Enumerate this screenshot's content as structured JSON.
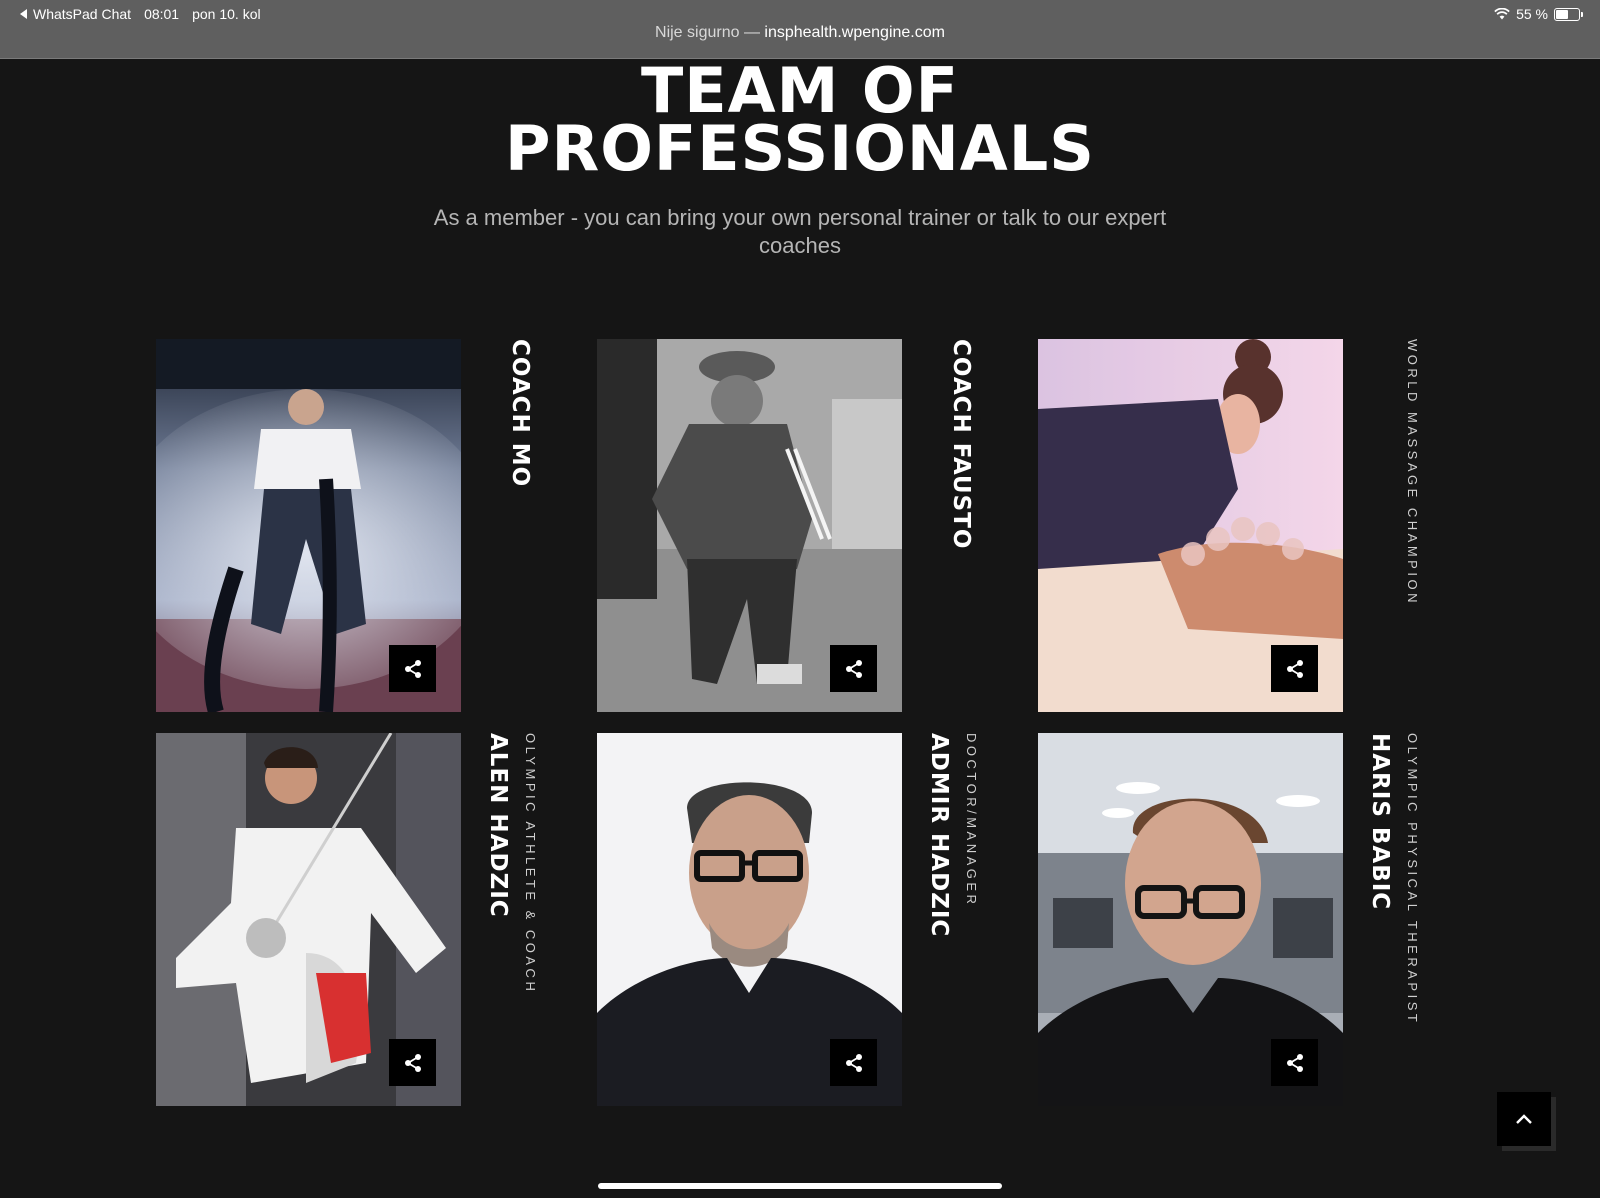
{
  "status_bar": {
    "back_app": "WhatsPad Chat",
    "time": "08:01",
    "date": "pon 10. kol",
    "battery": "55 %"
  },
  "address_bar": {
    "security": "Nije sigurno —",
    "domain": "insphealth.wpengine.com"
  },
  "section": {
    "title_line1": "TEAM OF",
    "title_line2": "PROFESSIONALS",
    "subtitle": "As a member - you can bring your own personal trainer or talk to our expert coaches"
  },
  "team": [
    {
      "name": "COACH MO",
      "role": ""
    },
    {
      "name": "COACH FAUSTO",
      "role": ""
    },
    {
      "name": "",
      "role": "WORLD MASSAGE CHAMPION"
    },
    {
      "name": "ALEN HADZIC",
      "role": "OLYMPIC ATHLETE & COACH"
    },
    {
      "name": "ADMIR HADZIC",
      "role": "DOCTOR/MANAGER"
    },
    {
      "name": "HARIS BABIC",
      "role": "OLYMPIC PHYSICAL THERAPIST"
    }
  ],
  "icons": {
    "share": "share-icon",
    "scroll_top": "chevron-up-icon",
    "wifi": "wifi-icon",
    "battery": "battery-icon"
  }
}
